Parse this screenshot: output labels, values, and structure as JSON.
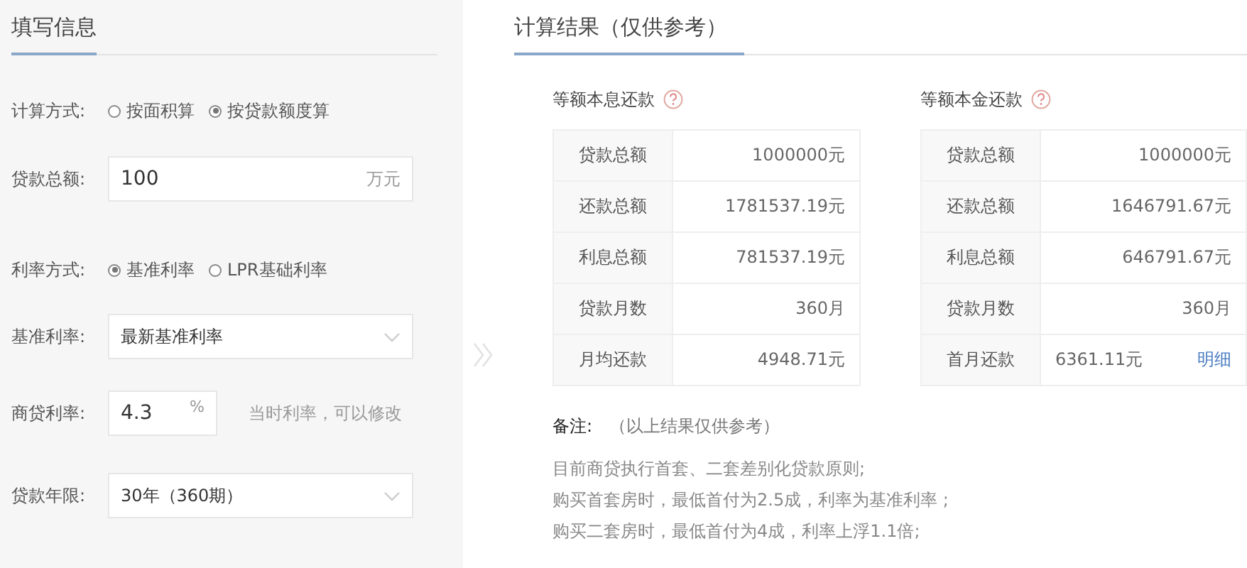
{
  "form": {
    "title": "填写信息",
    "calc_mode": {
      "label": "计算方式:",
      "options": [
        {
          "label": "按面积算",
          "selected": false
        },
        {
          "label": "按贷款额度算",
          "selected": true
        }
      ]
    },
    "loan_total": {
      "label": "贷款总额:",
      "value": "100",
      "unit": "万元"
    },
    "rate_mode": {
      "label": "利率方式:",
      "options": [
        {
          "label": "基准利率",
          "selected": true
        },
        {
          "label": "LPR基础利率",
          "selected": false
        }
      ]
    },
    "base_rate": {
      "label": "基准利率:",
      "value": "最新基准利率"
    },
    "commercial_rate": {
      "label": "商贷利率:",
      "value": "4.3",
      "unit": "%",
      "hint": "当时利率，可以修改"
    },
    "term": {
      "label": "贷款年限:",
      "value": "30年（360期）"
    }
  },
  "results": {
    "title": "计算结果（仅供参考）",
    "tables": [
      {
        "heading": "等额本息还款",
        "rows": [
          {
            "label": "贷款总额",
            "value": "1000000元"
          },
          {
            "label": "还款总额",
            "value": "1781537.19元"
          },
          {
            "label": "利息总额",
            "value": "781537.19元"
          },
          {
            "label": "贷款月数",
            "value": "360月"
          },
          {
            "label": "月均还款",
            "value": "4948.71元"
          }
        ]
      },
      {
        "heading": "等额本金还款",
        "rows": [
          {
            "label": "贷款总额",
            "value": "1000000元"
          },
          {
            "label": "还款总额",
            "value": "1646791.67元"
          },
          {
            "label": "利息总额",
            "value": "646791.67元"
          },
          {
            "label": "贷款月数",
            "value": "360月"
          },
          {
            "label": "首月还款",
            "value": "6361.11元",
            "link": "明细"
          }
        ]
      }
    ],
    "note": {
      "label": "备注:",
      "text": "（以上结果仅供参考）",
      "lines": [
        "目前商贷执行首套、二套差别化贷款原则;",
        "购买首套房时，最低首付为2.5成，利率为基准利率 ;",
        "购买二套房时，最低首付为4成，利率上浮1.1倍;"
      ]
    }
  }
}
